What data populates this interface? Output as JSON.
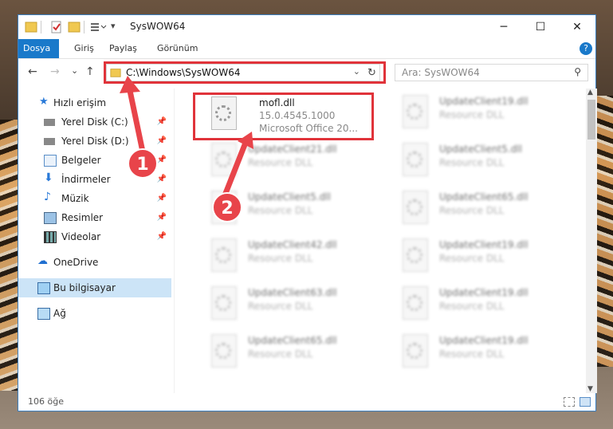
{
  "window": {
    "title": "SysWOW64",
    "minimize": "─",
    "maximize": "☐",
    "close": "✕"
  },
  "ribbon": {
    "tabs": [
      "Dosya",
      "Giriş",
      "Paylaş",
      "Görünüm"
    ],
    "help": "?"
  },
  "nav": {
    "back": "←",
    "forward": "→",
    "recent": "⌄",
    "up": "↑",
    "address": "C:\\Windows\\SysWOW64",
    "refresh": "↻",
    "search_placeholder": "Ara: SysWOW64"
  },
  "sidebar": {
    "items": [
      {
        "label": "Hızlı erişim",
        "icon": "star-icon",
        "pinned": false
      },
      {
        "label": "Yerel Disk (C:)",
        "icon": "drive-icon",
        "pinned": true
      },
      {
        "label": "Yerel Disk (D:)",
        "icon": "drive-icon",
        "pinned": true
      },
      {
        "label": "Belgeler",
        "icon": "documents-icon",
        "pinned": true
      },
      {
        "label": "İndirmeler",
        "icon": "download-icon",
        "pinned": true
      },
      {
        "label": "Müzik",
        "icon": "music-icon",
        "pinned": true
      },
      {
        "label": "Resimler",
        "icon": "pictures-icon",
        "pinned": true
      },
      {
        "label": "Videolar",
        "icon": "videos-icon",
        "pinned": true
      },
      {
        "label": "OneDrive",
        "icon": "cloud-icon",
        "pinned": false
      },
      {
        "label": "Bu bilgisayar",
        "icon": "computer-icon",
        "pinned": false,
        "selected": true
      },
      {
        "label": "Ağ",
        "icon": "network-icon",
        "pinned": false
      }
    ]
  },
  "files": {
    "highlighted": {
      "name": "mofl.dll",
      "version": "15.0.4545.1000",
      "description": "Microsoft Office 20..."
    },
    "tiles": [
      {
        "name": "UpdateClient19.dll",
        "type": "Resource DLL"
      },
      {
        "name": "UpdateClient21.dll",
        "type": "Resource DLL"
      },
      {
        "name": "UpdateClient5.dll",
        "type": "Resource DLL"
      },
      {
        "name": "UpdateClient5.dll",
        "type": "Resource DLL"
      },
      {
        "name": "UpdateClient65.dll",
        "type": "Resource DLL"
      },
      {
        "name": "UpdateClient42.dll",
        "type": "Resource DLL"
      },
      {
        "name": "UpdateClient19.dll",
        "type": "Resource DLL"
      },
      {
        "name": "UpdateClient63.dll",
        "type": "Resource DLL"
      },
      {
        "name": "UpdateClient19.dll",
        "type": "Resource DLL"
      },
      {
        "name": "UpdateClient65.dll",
        "type": "Resource DLL"
      },
      {
        "name": "UpdateClient19.dll",
        "type": "Resource DLL"
      }
    ]
  },
  "status": {
    "count": "106 öğe"
  },
  "annotations": {
    "step1": "1",
    "step2": "2"
  },
  "colors": {
    "accent": "#1979ca",
    "highlight": "#e0333a",
    "selected": "#cce4f7"
  }
}
